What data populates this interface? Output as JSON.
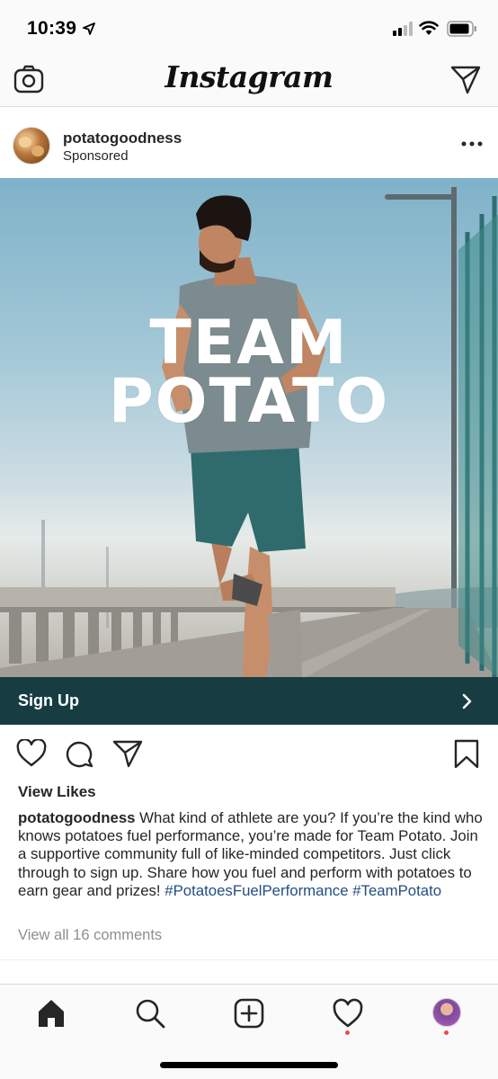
{
  "status_bar": {
    "time": "10:39"
  },
  "top_nav": {
    "logo": "Instagram",
    "icons": [
      "camera-icon",
      "direct-message-icon"
    ]
  },
  "post": {
    "username": "potatogoodness",
    "sponsored_label": "Sponsored",
    "ad_headline_line1": "TEAM",
    "ad_headline_line2": "POTATO",
    "cta_label": "Sign Up",
    "view_likes": "View Likes",
    "caption_user": "potatogoodness",
    "caption_text": " What kind of athlete are you? If you’re the kind who knows potatoes fuel performance, you’re made for Team Potato. Join a supportive community full of like-minded competitors. Just click through to sign up. Share how you fuel and perform with potatoes to earn gear and prizes! ",
    "hashtag1": "#PotatoesFuelPerformance",
    "hashtag2": "#TeamPotato",
    "view_comments": "View all 16 comments"
  },
  "colors": {
    "cta_background": "#173d42",
    "hashtag": "#234e82",
    "notification_dot": "#ed4956"
  },
  "tab_bar": {
    "items": [
      "home-icon",
      "search-icon",
      "new-post-icon",
      "activity-icon",
      "profile-avatar"
    ]
  }
}
